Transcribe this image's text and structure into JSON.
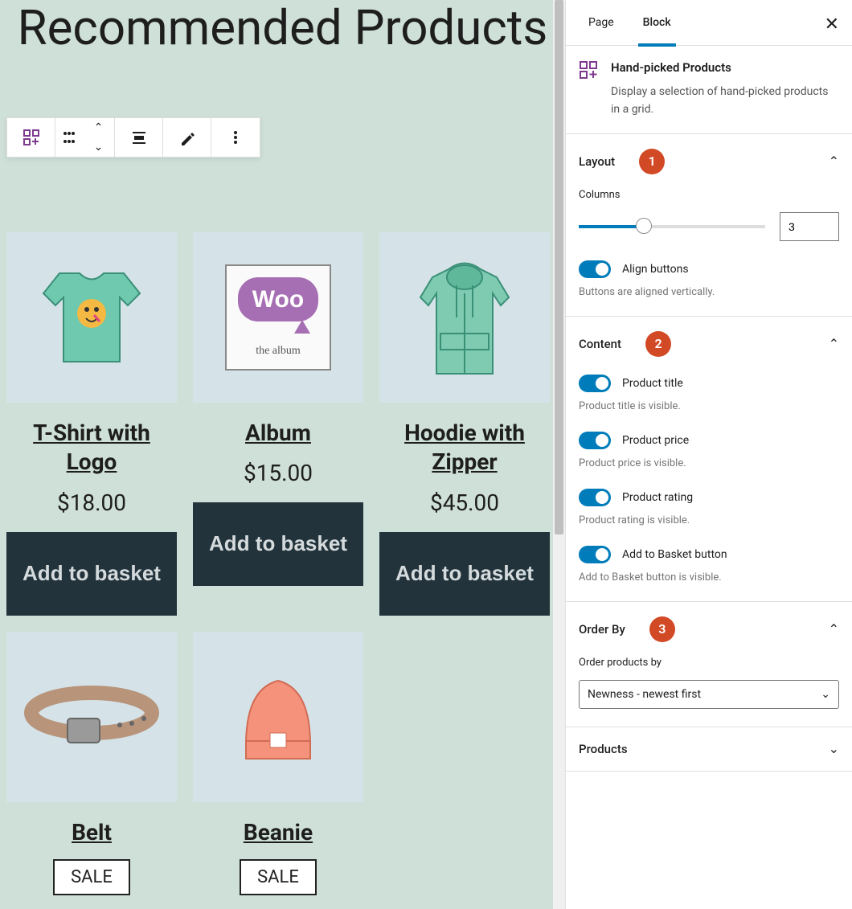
{
  "heading": "Recommended Products",
  "products": [
    {
      "title": "T-Shirt with Logo",
      "price": "$18.00",
      "cta": "Add to basket",
      "sale": false
    },
    {
      "title": "Album",
      "price": "$15.00",
      "cta": "Add to basket",
      "sale": false
    },
    {
      "title": "Hoodie with Zipper",
      "price": "$45.00",
      "cta": "Add to basket",
      "sale": false
    },
    {
      "title": "Belt",
      "price": "",
      "cta": "",
      "sale": true,
      "sale_label": "SALE"
    },
    {
      "title": "Beanie",
      "price": "",
      "cta": "",
      "sale": true,
      "sale_label": "SALE"
    }
  ],
  "sidebar": {
    "tabs": {
      "page": "Page",
      "block": "Block"
    },
    "block_name": "Hand-picked Products",
    "block_desc": "Display a selection of hand-picked products in a grid.",
    "panels": {
      "layout": {
        "title": "Layout",
        "badge": "1",
        "columns_label": "Columns",
        "columns_value": "3",
        "align_label": "Align buttons",
        "align_help": "Buttons are aligned vertically."
      },
      "content": {
        "title": "Content",
        "badge": "2",
        "toggles": [
          {
            "label": "Product title",
            "help": "Product title is visible."
          },
          {
            "label": "Product price",
            "help": "Product price is visible."
          },
          {
            "label": "Product rating",
            "help": "Product rating is visible."
          },
          {
            "label": "Add to Basket button",
            "help": "Add to Basket button is visible."
          }
        ]
      },
      "orderby": {
        "title": "Order By",
        "badge": "3",
        "label": "Order products by",
        "value": "Newness - newest first"
      },
      "products": {
        "title": "Products"
      }
    }
  }
}
